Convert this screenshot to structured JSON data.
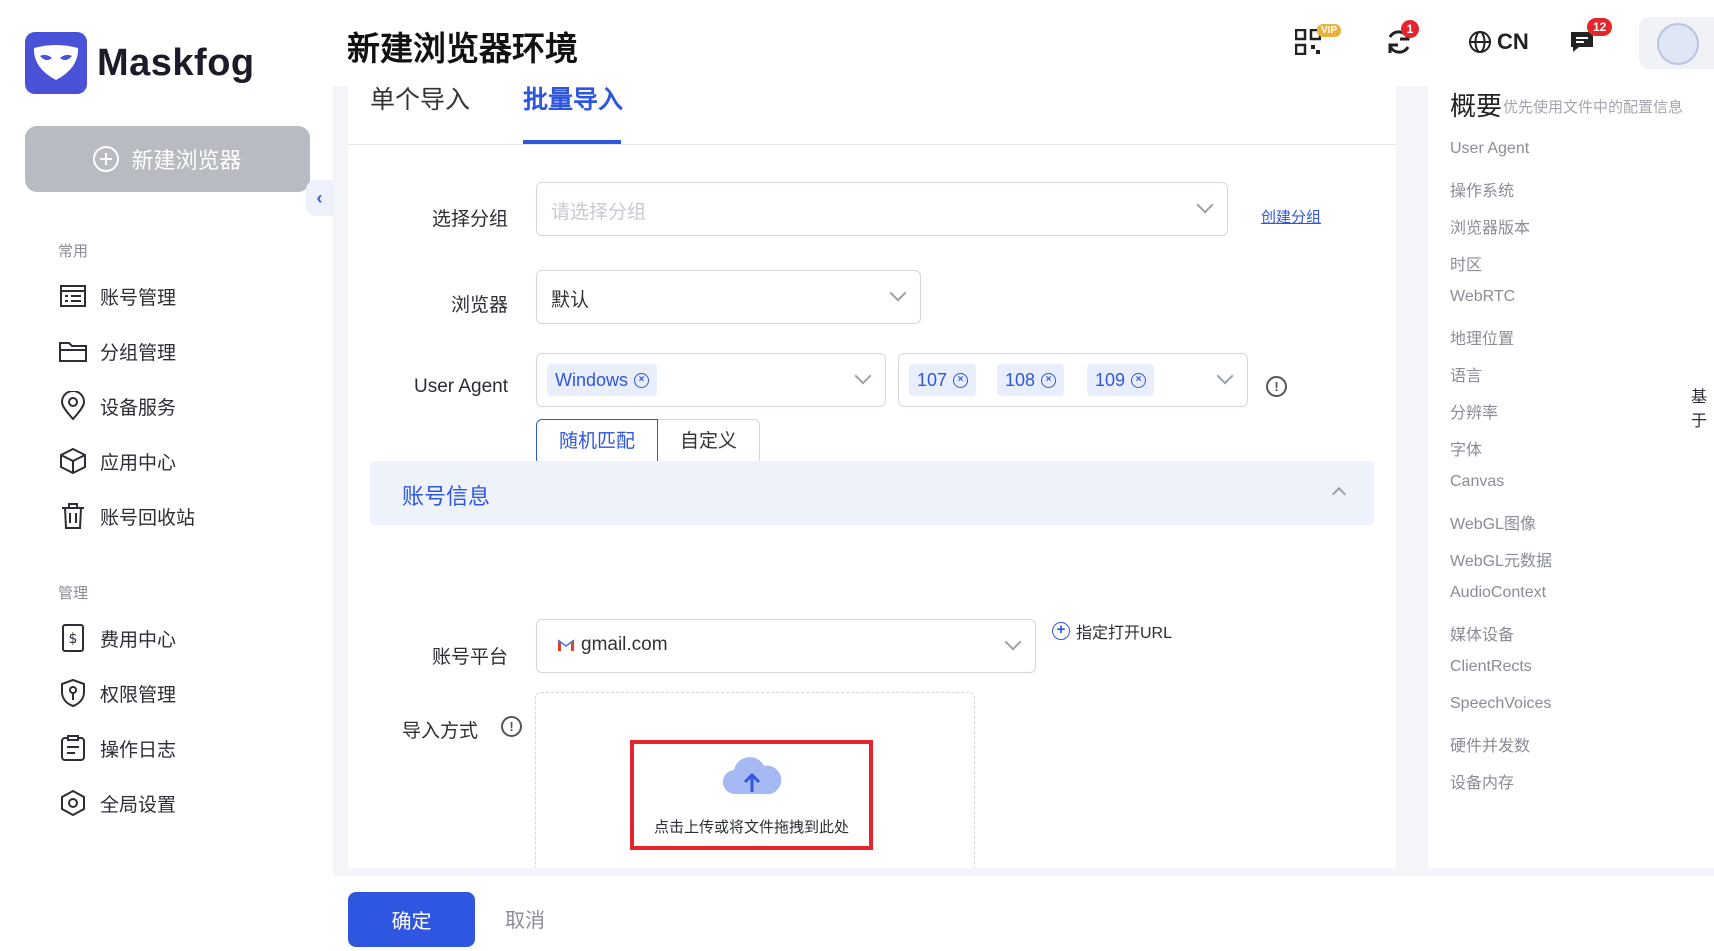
{
  "app": {
    "name": "Maskfog"
  },
  "sidebar": {
    "new_browser": "新建浏览器",
    "sections": [
      {
        "label": "常用",
        "items": [
          {
            "label": "账号管理",
            "icon": "account-list-icon"
          },
          {
            "label": "分组管理",
            "icon": "folder-icon"
          },
          {
            "label": "设备服务",
            "icon": "location-pin-icon"
          },
          {
            "label": "应用中心",
            "icon": "box-icon"
          },
          {
            "label": "账号回收站",
            "icon": "trash-icon"
          }
        ]
      },
      {
        "label": "管理",
        "items": [
          {
            "label": "费用中心",
            "icon": "dollar-doc-icon"
          },
          {
            "label": "权限管理",
            "icon": "shield-key-icon"
          },
          {
            "label": "操作日志",
            "icon": "clipboard-icon"
          },
          {
            "label": "全局设置",
            "icon": "hexagon-settings-icon"
          }
        ]
      }
    ]
  },
  "header": {
    "title": "新建浏览器环境",
    "vip_label": "VIP",
    "sync_badge": "1",
    "language": "CN",
    "messages_badge": "12"
  },
  "tabs": [
    {
      "label": "单个导入",
      "active": false
    },
    {
      "label": "批量导入",
      "active": true
    }
  ],
  "form": {
    "group": {
      "label": "选择分组",
      "placeholder": "请选择分组",
      "create_link": "创建分组"
    },
    "browser": {
      "label": "浏览器",
      "value": "默认"
    },
    "user_agent": {
      "label": "User Agent",
      "os_tags": [
        "Windows"
      ],
      "version_tags": [
        "107",
        "108",
        "109"
      ],
      "modes": [
        "随机匹配",
        "自定义"
      ],
      "active_mode": "随机匹配"
    },
    "account_section": "账号信息",
    "platform": {
      "label": "账号平台",
      "value": "gmail.com",
      "url_button": "指定打开URL"
    },
    "import_method": {
      "label": "导入方式",
      "upload_text": "点击上传或将文件拖拽到此处"
    }
  },
  "summary": {
    "title": "概要",
    "subtitle": "优先使用文件中的配置信息",
    "items": [
      "User Agent",
      "操作系统",
      "浏览器版本",
      "时区",
      "WebRTC",
      "地理位置",
      "语言",
      "分辨率",
      "字体",
      "Canvas",
      "WebGL图像",
      "WebGL元数据",
      "AudioContext",
      "媒体设备",
      "ClientRects",
      "SpeechVoices",
      "硬件并发数",
      "设备内存"
    ],
    "language_value": "基于"
  },
  "footer": {
    "confirm": "确定",
    "cancel": "取消"
  },
  "colors": {
    "accent": "#2f56e0",
    "brand": "#4a52d8",
    "badge": "#e5242b",
    "highlight": "#e5242b"
  }
}
